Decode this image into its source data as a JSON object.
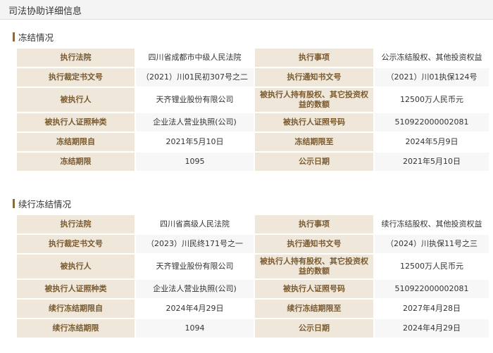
{
  "page": {
    "title": "司法协助详细信息"
  },
  "freeze": {
    "title": "冻结情况",
    "rows": [
      [
        "执行法院",
        "四川省成都市中级人民法院",
        "执行事项",
        "公示冻结股权、其他投资权益"
      ],
      [
        "执行裁定书文号",
        "（2021）川01民初307号之二",
        "执行通知书文号",
        "（2021）川01执保124号"
      ],
      [
        "被执行人",
        "天齐锂业股份有限公司",
        "被执行人持有股权、其它投资权益的数额",
        "12500万人民币元"
      ],
      [
        "被执行人证照种类",
        "企业法人营业执照(公司)",
        "被执行人证照号码",
        "510922000002081"
      ],
      [
        "冻结期限自",
        "2021年5月10日",
        "冻结期限至",
        "2024年5月9日"
      ],
      [
        "冻结期限",
        "1095",
        "公示日期",
        "2021年5月10日"
      ]
    ]
  },
  "renewal": {
    "title": "续行冻结情况",
    "rows": [
      [
        "执行法院",
        "四川省高级人民法院",
        "执行事项",
        "续行冻结股权、其他投资权益"
      ],
      [
        "执行裁定书文号",
        "（2023）川民终171号之一",
        "执行通知书文号",
        "（2024）川执保11号之三"
      ],
      [
        "被执行人",
        "天齐锂业股份有限公司",
        "被执行人持有股权、其它投资权益的数额",
        "12500万人民币元"
      ],
      [
        "被执行人证照种类",
        "企业法人营业执照(公司)",
        "被执行人证照号码",
        "510922000002081"
      ],
      [
        "续行冻结期限自",
        "2024年4月29日",
        "续行冻结期限至",
        "2027年4月28日"
      ],
      [
        "续行冻结期限",
        "1094",
        "公示日期",
        "2024年4月29日"
      ]
    ]
  }
}
